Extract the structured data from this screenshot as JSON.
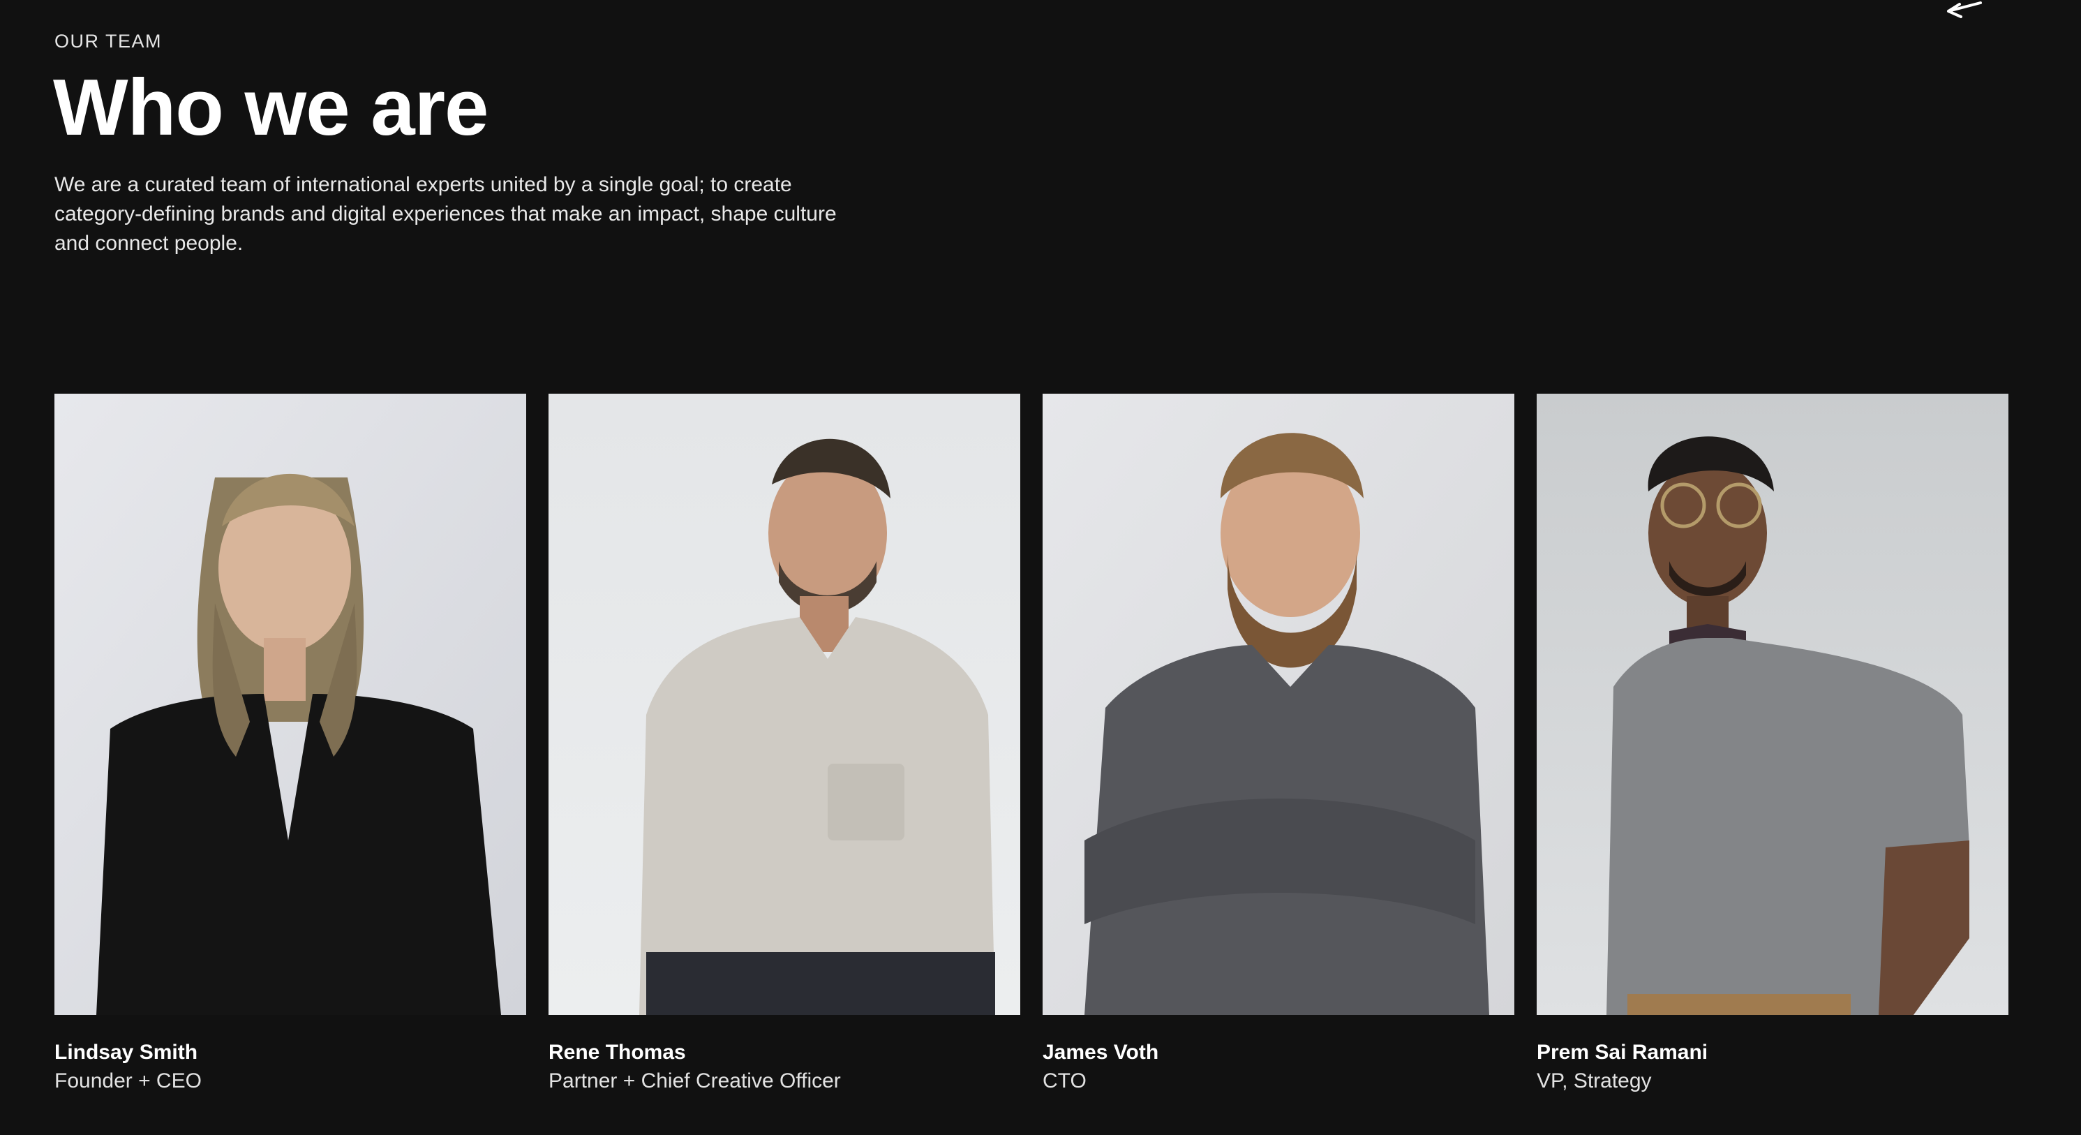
{
  "section": {
    "eyebrow": "OUR TEAM",
    "title": "Who we are",
    "intro": "We are a curated team of international experts united by a single goal; to create category-defining brands and digital experiences that make an impact, shape culture and connect people."
  },
  "nav": {
    "arrow_icon": "arrow-icon"
  },
  "team": [
    {
      "name": "Lindsay Smith",
      "role": "Founder + CEO"
    },
    {
      "name": "Rene Thomas",
      "role": "Partner + Chief Creative Officer"
    },
    {
      "name": "James Voth",
      "role": "CTO"
    },
    {
      "name": "Prem Sai Ramani",
      "role": "VP, Strategy"
    }
  ],
  "colors": {
    "background": "#111111",
    "text": "#ffffff"
  }
}
